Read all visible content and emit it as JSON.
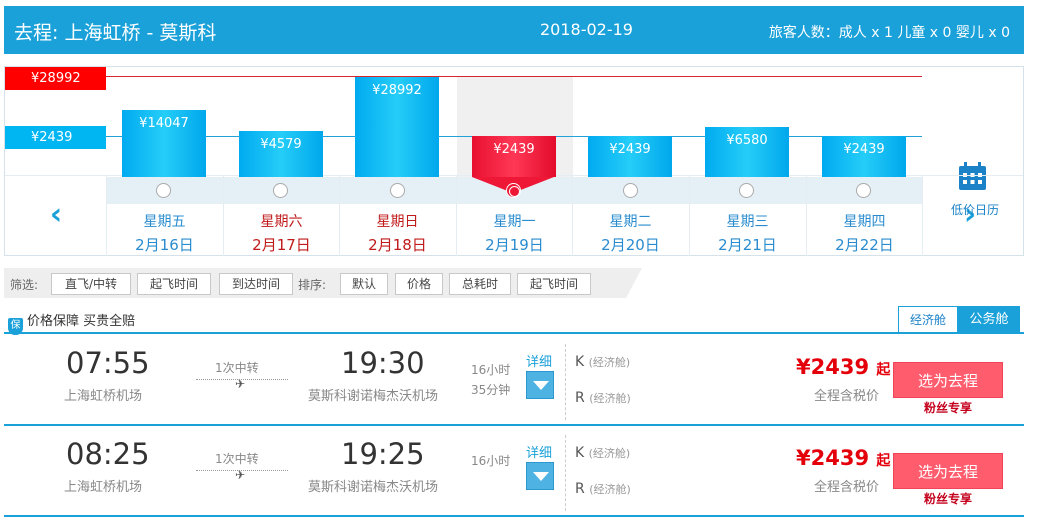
{
  "header": {
    "route": "去程:   上海虹桥 - 莫斯科",
    "date": "2018-02-19",
    "passengers": "旅客人数：成人 x 1    儿童 x 0    婴儿 x 0"
  },
  "calendar": {
    "max_label": "¥28992",
    "min_label": "¥2439",
    "low_price_calendar_label": "低价日历",
    "days": [
      {
        "weekday": "星期五",
        "date": "2月16日",
        "price": "¥14047",
        "value": 14047,
        "weekend": false,
        "selected": false
      },
      {
        "weekday": "星期六",
        "date": "2月17日",
        "price": "¥4579",
        "value": 4579,
        "weekend": true,
        "selected": false
      },
      {
        "weekday": "星期日",
        "date": "2月18日",
        "price": "¥28992",
        "value": 28992,
        "weekend": true,
        "selected": false
      },
      {
        "weekday": "星期一",
        "date": "2月19日",
        "price": "¥2439",
        "value": 2439,
        "weekend": false,
        "selected": true
      },
      {
        "weekday": "星期二",
        "date": "2月20日",
        "price": "¥2439",
        "value": 2439,
        "weekend": false,
        "selected": false
      },
      {
        "weekday": "星期三",
        "date": "2月21日",
        "price": "¥6580",
        "value": 6580,
        "weekend": false,
        "selected": false
      },
      {
        "weekday": "星期四",
        "date": "2月22日",
        "price": "¥2439",
        "value": 2439,
        "weekend": false,
        "selected": false
      }
    ]
  },
  "filters": {
    "filter_label": "筛选:",
    "filter_buttons": [
      "直飞/中转",
      "起飞时间",
      "到达时间"
    ],
    "sort_label": "排序:",
    "sort_buttons": [
      "默认",
      "价格",
      "总耗时",
      "起飞时间"
    ]
  },
  "guarantee": {
    "icon_char": "保",
    "text": "价格保障 买贵全赔"
  },
  "cabin_tabs": {
    "economy": "经济舱",
    "business": "公务舱"
  },
  "flights": [
    {
      "dep_time": "07:55",
      "dep_airport": "上海虹桥机场",
      "stops": "1次中转",
      "arr_time": "19:30",
      "arr_airport": "莫斯科谢诺梅杰沃机场",
      "duration_1": "16小时",
      "duration_2": "35分钟",
      "detail": "详细",
      "cabins": [
        {
          "code": "K",
          "name": "(经济舱)"
        },
        {
          "code": "R",
          "name": "(经济舱)"
        }
      ],
      "price": "¥2439",
      "price_suffix": "起",
      "tax_note": "全程含税价",
      "book": "选为去程",
      "promo": "粉丝专享"
    },
    {
      "dep_time": "08:25",
      "dep_airport": "上海虹桥机场",
      "stops": "1次中转",
      "arr_time": "19:25",
      "arr_airport": "莫斯科谢诺梅杰沃机场",
      "duration_1": "16小时",
      "duration_2": "",
      "detail": "详细",
      "cabins": [
        {
          "code": "K",
          "name": "(经济舱)"
        },
        {
          "code": "R",
          "name": "(经济舱)"
        }
      ],
      "price": "¥2439",
      "price_suffix": "起",
      "tax_note": "全程含税价",
      "book": "选为去程",
      "promo": "粉丝专享"
    }
  ]
}
